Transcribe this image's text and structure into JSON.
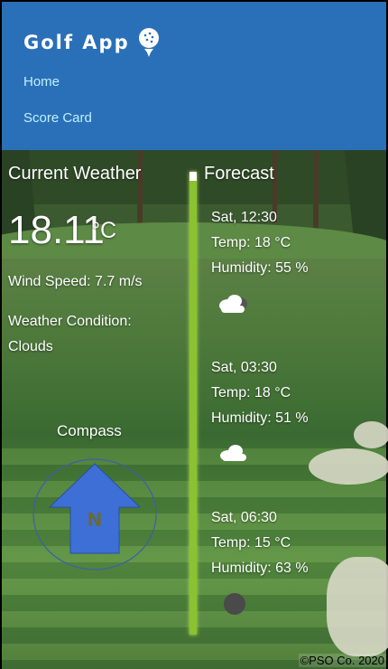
{
  "header": {
    "app_title": "Golf App",
    "nav": [
      {
        "label": "Home"
      },
      {
        "label": "Score Card"
      }
    ]
  },
  "current": {
    "heading": "Current Weather",
    "temperature": "18.11",
    "unit": "°C",
    "wind": "Wind Speed: 7.7 m/s",
    "condition_label": "Weather Condition:",
    "condition_value": "Clouds",
    "compass_label": "Compass",
    "compass_letter": "N"
  },
  "forecast": {
    "heading": "Forecast",
    "items": [
      {
        "time": "Sat, 12:30",
        "temp": "Temp: 18 °C",
        "humidity": "Humidity: 55 %",
        "icon": "cloud-icon"
      },
      {
        "time": "Sat, 03:30",
        "temp": "Temp: 18 °C",
        "humidity": "Humidity: 51 %",
        "icon": "cloud-icon"
      },
      {
        "time": "Sat, 06:30",
        "temp": "Temp: 15 °C",
        "humidity": "Humidity: 63 %",
        "icon": "dark-cloud-icon"
      }
    ]
  },
  "footer": {
    "text": "©PSO Co. 2020"
  },
  "colors": {
    "header": "#2a70b8",
    "nav_link": "#bff0ff",
    "divider": "#8ac232",
    "compass_arrow": "#3d6fd6"
  }
}
